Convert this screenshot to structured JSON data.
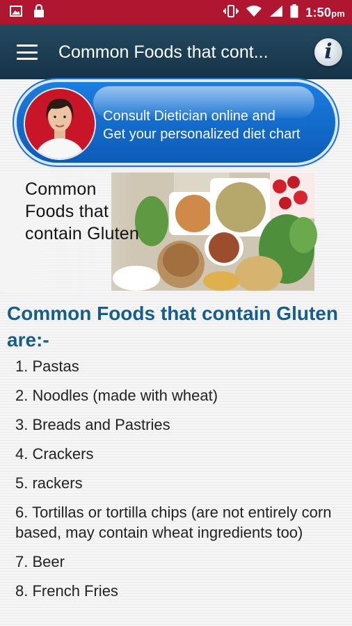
{
  "status_bar": {
    "time": "1:50",
    "ampm": "pm",
    "icons": [
      "image-icon",
      "lock-icon",
      "vibrate-icon",
      "wifi-icon",
      "signal-icon",
      "battery-icon"
    ]
  },
  "app_bar": {
    "title": "Common Foods that cont...",
    "menu_icon": "hamburger-menu-icon",
    "info_icon": "info-icon",
    "info_glyph": "i"
  },
  "banner": {
    "line1": "Consult Dietician online and",
    "line2": "Get your personalized diet chart"
  },
  "hero": {
    "line1": "Common",
    "line2": "Foods that",
    "line3": "contain Gluten"
  },
  "article": {
    "heading": "Common Foods that contain Gluten are:-",
    "items": [
      "1. Pastas",
      "2. Noodles (made with wheat)",
      "3. Breads and Pastries",
      "4. Crackers",
      "5. rackers",
      "6. Tortillas or tortilla chips (are not entirely corn based, may contain wheat ingredients too)",
      "7. Beer",
      "8. French Fries"
    ]
  },
  "colors": {
    "status_bar": "#b0162f",
    "app_bar": "#1d4256",
    "heading": "#165e8a",
    "banner": "#1471d4"
  }
}
